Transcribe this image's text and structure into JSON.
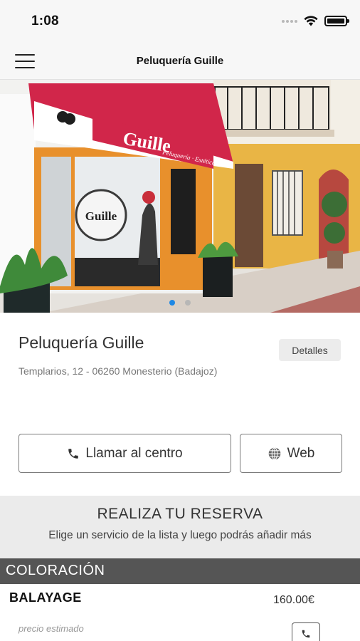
{
  "status_bar": {
    "time": "1:08",
    "icons": [
      "signal-icon",
      "wifi-icon",
      "battery-icon"
    ]
  },
  "header": {
    "title": "Peluquería Guille",
    "menu_icon": "hamburger-menu-icon"
  },
  "hero": {
    "sign_text": "Guille",
    "sign_subtext": "Peluquería · Estética",
    "logo_text": "Guille",
    "carousel_total": 2,
    "carousel_active": 1
  },
  "salon": {
    "name": "Peluquería Guille",
    "address": "Templarios, 12 - 06260 Monesterio (Badajoz)",
    "details_label": "Detalles"
  },
  "actions": {
    "call_label": "Llamar al centro",
    "call_icon": "phone-icon",
    "web_label": "Web",
    "web_icon": "globe-icon"
  },
  "reservation": {
    "title": "REALIZA TU RESERVA",
    "subtitle": "Elige un servicio de la lista y luego podrás añadir más"
  },
  "services": {
    "category": "COLORACIÓN",
    "items": [
      {
        "name": "BALAYAGE",
        "price": "160.00€",
        "note": "precio estimado",
        "action_icon": "phone-icon"
      }
    ]
  },
  "colors": {
    "accent": "#1e88e5",
    "category_bar": "#555555",
    "reserva_bg": "#ebebeb",
    "awning_red": "#d1264a",
    "facade_orange": "#e8902c"
  }
}
